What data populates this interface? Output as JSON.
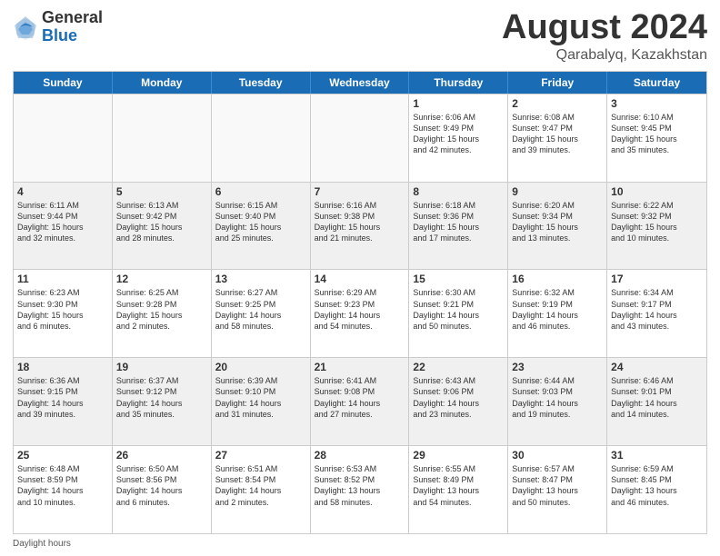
{
  "header": {
    "logo_line1": "General",
    "logo_line2": "Blue",
    "month": "August 2024",
    "location": "Qarabalyq, Kazakhstan"
  },
  "weekdays": [
    "Sunday",
    "Monday",
    "Tuesday",
    "Wednesday",
    "Thursday",
    "Friday",
    "Saturday"
  ],
  "weeks": [
    [
      {
        "day": "",
        "empty": true,
        "lines": []
      },
      {
        "day": "",
        "empty": true,
        "lines": []
      },
      {
        "day": "",
        "empty": true,
        "lines": []
      },
      {
        "day": "",
        "empty": true,
        "lines": []
      },
      {
        "day": "1",
        "lines": [
          "Sunrise: 6:06 AM",
          "Sunset: 9:49 PM",
          "Daylight: 15 hours",
          "and 42 minutes."
        ]
      },
      {
        "day": "2",
        "lines": [
          "Sunrise: 6:08 AM",
          "Sunset: 9:47 PM",
          "Daylight: 15 hours",
          "and 39 minutes."
        ]
      },
      {
        "day": "3",
        "lines": [
          "Sunrise: 6:10 AM",
          "Sunset: 9:45 PM",
          "Daylight: 15 hours",
          "and 35 minutes."
        ]
      }
    ],
    [
      {
        "day": "4",
        "lines": [
          "Sunrise: 6:11 AM",
          "Sunset: 9:44 PM",
          "Daylight: 15 hours",
          "and 32 minutes."
        ]
      },
      {
        "day": "5",
        "lines": [
          "Sunrise: 6:13 AM",
          "Sunset: 9:42 PM",
          "Daylight: 15 hours",
          "and 28 minutes."
        ]
      },
      {
        "day": "6",
        "lines": [
          "Sunrise: 6:15 AM",
          "Sunset: 9:40 PM",
          "Daylight: 15 hours",
          "and 25 minutes."
        ]
      },
      {
        "day": "7",
        "lines": [
          "Sunrise: 6:16 AM",
          "Sunset: 9:38 PM",
          "Daylight: 15 hours",
          "and 21 minutes."
        ]
      },
      {
        "day": "8",
        "lines": [
          "Sunrise: 6:18 AM",
          "Sunset: 9:36 PM",
          "Daylight: 15 hours",
          "and 17 minutes."
        ]
      },
      {
        "day": "9",
        "lines": [
          "Sunrise: 6:20 AM",
          "Sunset: 9:34 PM",
          "Daylight: 15 hours",
          "and 13 minutes."
        ]
      },
      {
        "day": "10",
        "lines": [
          "Sunrise: 6:22 AM",
          "Sunset: 9:32 PM",
          "Daylight: 15 hours",
          "and 10 minutes."
        ]
      }
    ],
    [
      {
        "day": "11",
        "lines": [
          "Sunrise: 6:23 AM",
          "Sunset: 9:30 PM",
          "Daylight: 15 hours",
          "and 6 minutes."
        ]
      },
      {
        "day": "12",
        "lines": [
          "Sunrise: 6:25 AM",
          "Sunset: 9:28 PM",
          "Daylight: 15 hours",
          "and 2 minutes."
        ]
      },
      {
        "day": "13",
        "lines": [
          "Sunrise: 6:27 AM",
          "Sunset: 9:25 PM",
          "Daylight: 14 hours",
          "and 58 minutes."
        ]
      },
      {
        "day": "14",
        "lines": [
          "Sunrise: 6:29 AM",
          "Sunset: 9:23 PM",
          "Daylight: 14 hours",
          "and 54 minutes."
        ]
      },
      {
        "day": "15",
        "lines": [
          "Sunrise: 6:30 AM",
          "Sunset: 9:21 PM",
          "Daylight: 14 hours",
          "and 50 minutes."
        ]
      },
      {
        "day": "16",
        "lines": [
          "Sunrise: 6:32 AM",
          "Sunset: 9:19 PM",
          "Daylight: 14 hours",
          "and 46 minutes."
        ]
      },
      {
        "day": "17",
        "lines": [
          "Sunrise: 6:34 AM",
          "Sunset: 9:17 PM",
          "Daylight: 14 hours",
          "and 43 minutes."
        ]
      }
    ],
    [
      {
        "day": "18",
        "lines": [
          "Sunrise: 6:36 AM",
          "Sunset: 9:15 PM",
          "Daylight: 14 hours",
          "and 39 minutes."
        ]
      },
      {
        "day": "19",
        "lines": [
          "Sunrise: 6:37 AM",
          "Sunset: 9:12 PM",
          "Daylight: 14 hours",
          "and 35 minutes."
        ]
      },
      {
        "day": "20",
        "lines": [
          "Sunrise: 6:39 AM",
          "Sunset: 9:10 PM",
          "Daylight: 14 hours",
          "and 31 minutes."
        ]
      },
      {
        "day": "21",
        "lines": [
          "Sunrise: 6:41 AM",
          "Sunset: 9:08 PM",
          "Daylight: 14 hours",
          "and 27 minutes."
        ]
      },
      {
        "day": "22",
        "lines": [
          "Sunrise: 6:43 AM",
          "Sunset: 9:06 PM",
          "Daylight: 14 hours",
          "and 23 minutes."
        ]
      },
      {
        "day": "23",
        "lines": [
          "Sunrise: 6:44 AM",
          "Sunset: 9:03 PM",
          "Daylight: 14 hours",
          "and 19 minutes."
        ]
      },
      {
        "day": "24",
        "lines": [
          "Sunrise: 6:46 AM",
          "Sunset: 9:01 PM",
          "Daylight: 14 hours",
          "and 14 minutes."
        ]
      }
    ],
    [
      {
        "day": "25",
        "lines": [
          "Sunrise: 6:48 AM",
          "Sunset: 8:59 PM",
          "Daylight: 14 hours",
          "and 10 minutes."
        ]
      },
      {
        "day": "26",
        "lines": [
          "Sunrise: 6:50 AM",
          "Sunset: 8:56 PM",
          "Daylight: 14 hours",
          "and 6 minutes."
        ]
      },
      {
        "day": "27",
        "lines": [
          "Sunrise: 6:51 AM",
          "Sunset: 8:54 PM",
          "Daylight: 14 hours",
          "and 2 minutes."
        ]
      },
      {
        "day": "28",
        "lines": [
          "Sunrise: 6:53 AM",
          "Sunset: 8:52 PM",
          "Daylight: 13 hours",
          "and 58 minutes."
        ]
      },
      {
        "day": "29",
        "lines": [
          "Sunrise: 6:55 AM",
          "Sunset: 8:49 PM",
          "Daylight: 13 hours",
          "and 54 minutes."
        ]
      },
      {
        "day": "30",
        "lines": [
          "Sunrise: 6:57 AM",
          "Sunset: 8:47 PM",
          "Daylight: 13 hours",
          "and 50 minutes."
        ]
      },
      {
        "day": "31",
        "lines": [
          "Sunrise: 6:59 AM",
          "Sunset: 8:45 PM",
          "Daylight: 13 hours",
          "and 46 minutes."
        ]
      }
    ]
  ],
  "footer": "Daylight hours"
}
